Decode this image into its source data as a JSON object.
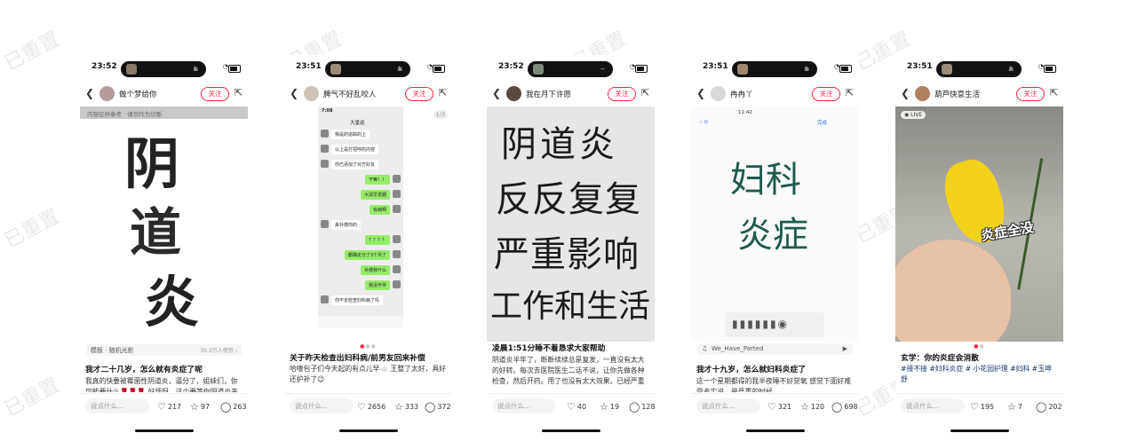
{
  "watermark": "已重置",
  "posts": [
    {
      "time": "23:52",
      "author": "做个梦给你",
      "follow": "关注",
      "overlay_note": "内容仅供参考 · 请勿作为诊断",
      "image_text": [
        "阴",
        "道",
        "炎"
      ],
      "template_label": "模板 · 随机光影",
      "template_count": "30.3万人使用 ›",
      "title": "我才二十几岁，怎么就有炎症了呢",
      "body": "我真的快要被霉菌性阴道炎，逼分了，姐妹们，你可能要什么🌹🌹🌹 好烦呀，这个要等你阴道炎来",
      "comment_placeholder": "说点什么...",
      "likes": "217",
      "collects": "97",
      "comments": "263"
    },
    {
      "time": "23:51",
      "author": "脾气不好乱咬人",
      "follow": "关注",
      "page_badge": "1/3",
      "chat_time": "7:08",
      "chat_contact": "大皇巡",
      "chat_msgs": [
        {
          "side": "l",
          "text": "我是的追踪的上"
        },
        {
          "side": "l",
          "text": "以上是打招呼的内容"
        },
        {
          "side": "l",
          "text": "你已添加了对方好友"
        },
        {
          "side": "r",
          "text": "干嘛！！"
        },
        {
          "side": "r",
          "text": "大清早发圈"
        },
        {
          "side": "r",
          "text": "有病啊"
        },
        {
          "side": "l",
          "text": "来补偿你的"
        },
        {
          "side": "r",
          "text": "？？？？"
        },
        {
          "side": "r",
          "text": "都确定分了3个月了"
        },
        {
          "side": "r",
          "text": "补偿我什么"
        },
        {
          "side": "r",
          "text": "我没怀孕"
        },
        {
          "side": "l",
          "text": "你不去检查妇科病了吗"
        }
      ],
      "title": "关于昨天检查出妇科病/前男友回来补偿",
      "body": "哈喽包子们今天起的有点儿早☁️ 王整了太好，具好还护补了😉",
      "comment_placeholder": "说点什么...",
      "likes": "2656",
      "collects": "333",
      "comments": "372"
    },
    {
      "time": "23:52",
      "author": "我在月下许愿",
      "follow": "关注",
      "image_lines": [
        "阴道炎",
        "反反复复",
        "严重影响",
        "工作和生活"
      ],
      "title": "凌晨1:51分睡不着恳求大家帮助",
      "body": "阴道炎半年了，断断续续总是复发，一直没有太大的好转。每次去医院医生二话不说，让你先做各种检查，然后开药。用了也没有太大效果。已经严重",
      "comment_placeholder": "说点什么...",
      "likes": "40",
      "collects": "19",
      "comments": "128"
    },
    {
      "time": "23:51",
      "author": "冉冉丫",
      "follow": "关注",
      "note_time": "11:42",
      "note_done": "完成",
      "image_lines": [
        "妇科",
        "炎症"
      ],
      "music": "We_Have_Parted",
      "title": "我才十九岁，怎么就妇科炎症了",
      "body": "这一个星期都得的我半夜睡不好觉氧 感觉下面好难受老实说，最严重的时候",
      "comment_placeholder": "说点什么...",
      "likes": "321",
      "collects": "120",
      "comments": "698"
    },
    {
      "time": "23:51",
      "author": "葫芦快意生活",
      "follow": "关注",
      "live_badge": "LIVE",
      "sticker": "炎症全没",
      "title": "玄学：你的炎症会消散",
      "tags": "#接不接 #妇科炎症 # 小花园护理 #妇科 #玉坤舒",
      "comment_placeholder": "说点什么...",
      "likes": "195",
      "collects": "7",
      "comments": "202"
    }
  ],
  "colors": {
    "accent": "#ff2442",
    "chat_bg": "#ededed",
    "chat_green": "#95ec69",
    "ink_green": "#1e5a4e"
  },
  "icons": {
    "back": "chevron-left-icon",
    "share": "share-icon",
    "like": "heart-icon",
    "collect": "star-icon",
    "comment": "comment-icon"
  }
}
